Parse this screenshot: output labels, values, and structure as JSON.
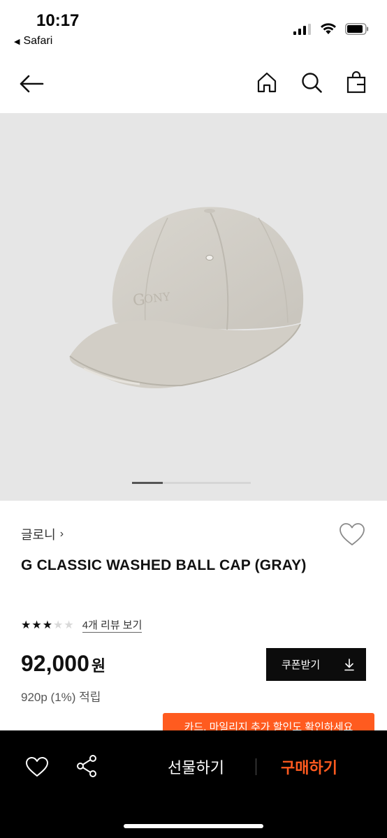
{
  "status_bar": {
    "time": "10:17",
    "back_app": "Safari",
    "icons": [
      "cellular-signal-icon",
      "wifi-icon",
      "battery-icon"
    ]
  },
  "nav": {
    "icons": [
      "back-arrow-icon",
      "home-icon",
      "search-icon",
      "shopping-bag-icon"
    ]
  },
  "gallery": {
    "image": "gray washed ball cap",
    "page": 1
  },
  "product": {
    "brand": "글로니",
    "name": "G CLASSIC WASHED BALL CAP (GRAY)",
    "rating": 3,
    "rating_max": 5,
    "review_link": "4개 리뷰 보기",
    "price": "92,000",
    "price_unit": "원",
    "points": "920p (1%) 적립",
    "coupon_button": "쿠폰받기",
    "promo_banner": "카드, 마일리지 추가 할인도 확인하세요"
  },
  "bottom_bar": {
    "gift_label": "선물하기",
    "buy_label": "구매하기",
    "buy_color": "#ff5a1f"
  },
  "colors": {
    "accent": "#ff5b1f",
    "button_bg": "#0c0c0c",
    "gallery_bg": "#e6e6e6"
  }
}
